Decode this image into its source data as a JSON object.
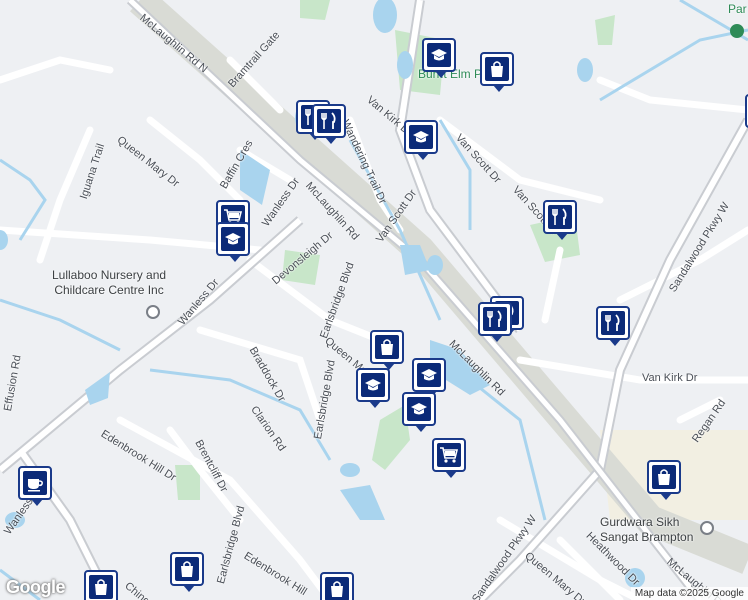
{
  "colors": {
    "background": "#eef0f3",
    "road": "#ffffff",
    "arterial": "#c9ccd1",
    "water": "#a9d4ee",
    "park": "#c8e6c9",
    "rail": "#d9dbd5",
    "pin_border": "#1a3a8a",
    "pin_fill": "#0b2a78"
  },
  "streets": [
    "McLaughlin Rd N",
    "Bramtrail Gate",
    "Iguana Trail",
    "Queen Mary Dr",
    "Baffin Cres",
    "Wanless Dr",
    "McLaughlin Rd",
    "Wandering Trail Dr",
    "Van Kirk Dr",
    "Van Scott Dr",
    "Van Scott Dr",
    "Van Scott Dr",
    "Devonsleigh Dr",
    "Earlsbridge Blvd",
    "Wanless Dr",
    "Sandalwood Pkwy W",
    "Queen Ma",
    "Braddock Dr",
    "McLaughlin Rd",
    "Van Kirk Dr",
    "Earlsbridge Blvd",
    "Clarion Rd",
    "Regan Rd",
    "Edenbrook Hill Dr",
    "Brentcliff Dr",
    "Wanless Dr",
    "Edenbrook Hill",
    "Earlsbridge Blvd",
    "Sandalwood Pkwy W",
    "Queen Mary Dr",
    "Heathwood Dr",
    "McLaughlin Rd",
    "Chingua",
    "Effusion Rd",
    "Sangat Brampton"
  ],
  "parks": [
    "Burnt Elm Park",
    "Par"
  ],
  "places": [
    {
      "name": "Lullaboo Nursery and Childcare Centre Inc",
      "line1": "Lullaboo Nursery and",
      "line2": "Childcare Centre Inc"
    },
    {
      "name": "Gurdwara Sikh Sangat Brampton",
      "line1": "Gurdwara Sikh",
      "line2": "Sangat Brampton"
    }
  ],
  "markers": [
    {
      "type": "school-icon"
    },
    {
      "type": "shopping-bag-icon"
    },
    {
      "type": "restaurant-icon"
    },
    {
      "type": "restaurant-icon"
    },
    {
      "type": "school-icon"
    },
    {
      "type": "shopping-cart-icon"
    },
    {
      "type": "school-icon"
    },
    {
      "type": "restaurant-icon"
    },
    {
      "type": "restaurant-icon"
    },
    {
      "type": "restaurant-icon"
    },
    {
      "type": "shopping-bag-icon"
    },
    {
      "type": "restaurant-icon"
    },
    {
      "type": "school-icon"
    },
    {
      "type": "school-icon"
    },
    {
      "type": "school-icon"
    },
    {
      "type": "shopping-cart-icon"
    },
    {
      "type": "shopping-bag-icon"
    },
    {
      "type": "coffee-icon"
    },
    {
      "type": "shopping-bag-icon"
    },
    {
      "type": "shopping-bag-icon"
    },
    {
      "type": "shopping-bag-icon"
    },
    {
      "type": "school-icon"
    }
  ],
  "branding": {
    "logo": "Google",
    "attribution": "Map data ©2025 Google"
  }
}
